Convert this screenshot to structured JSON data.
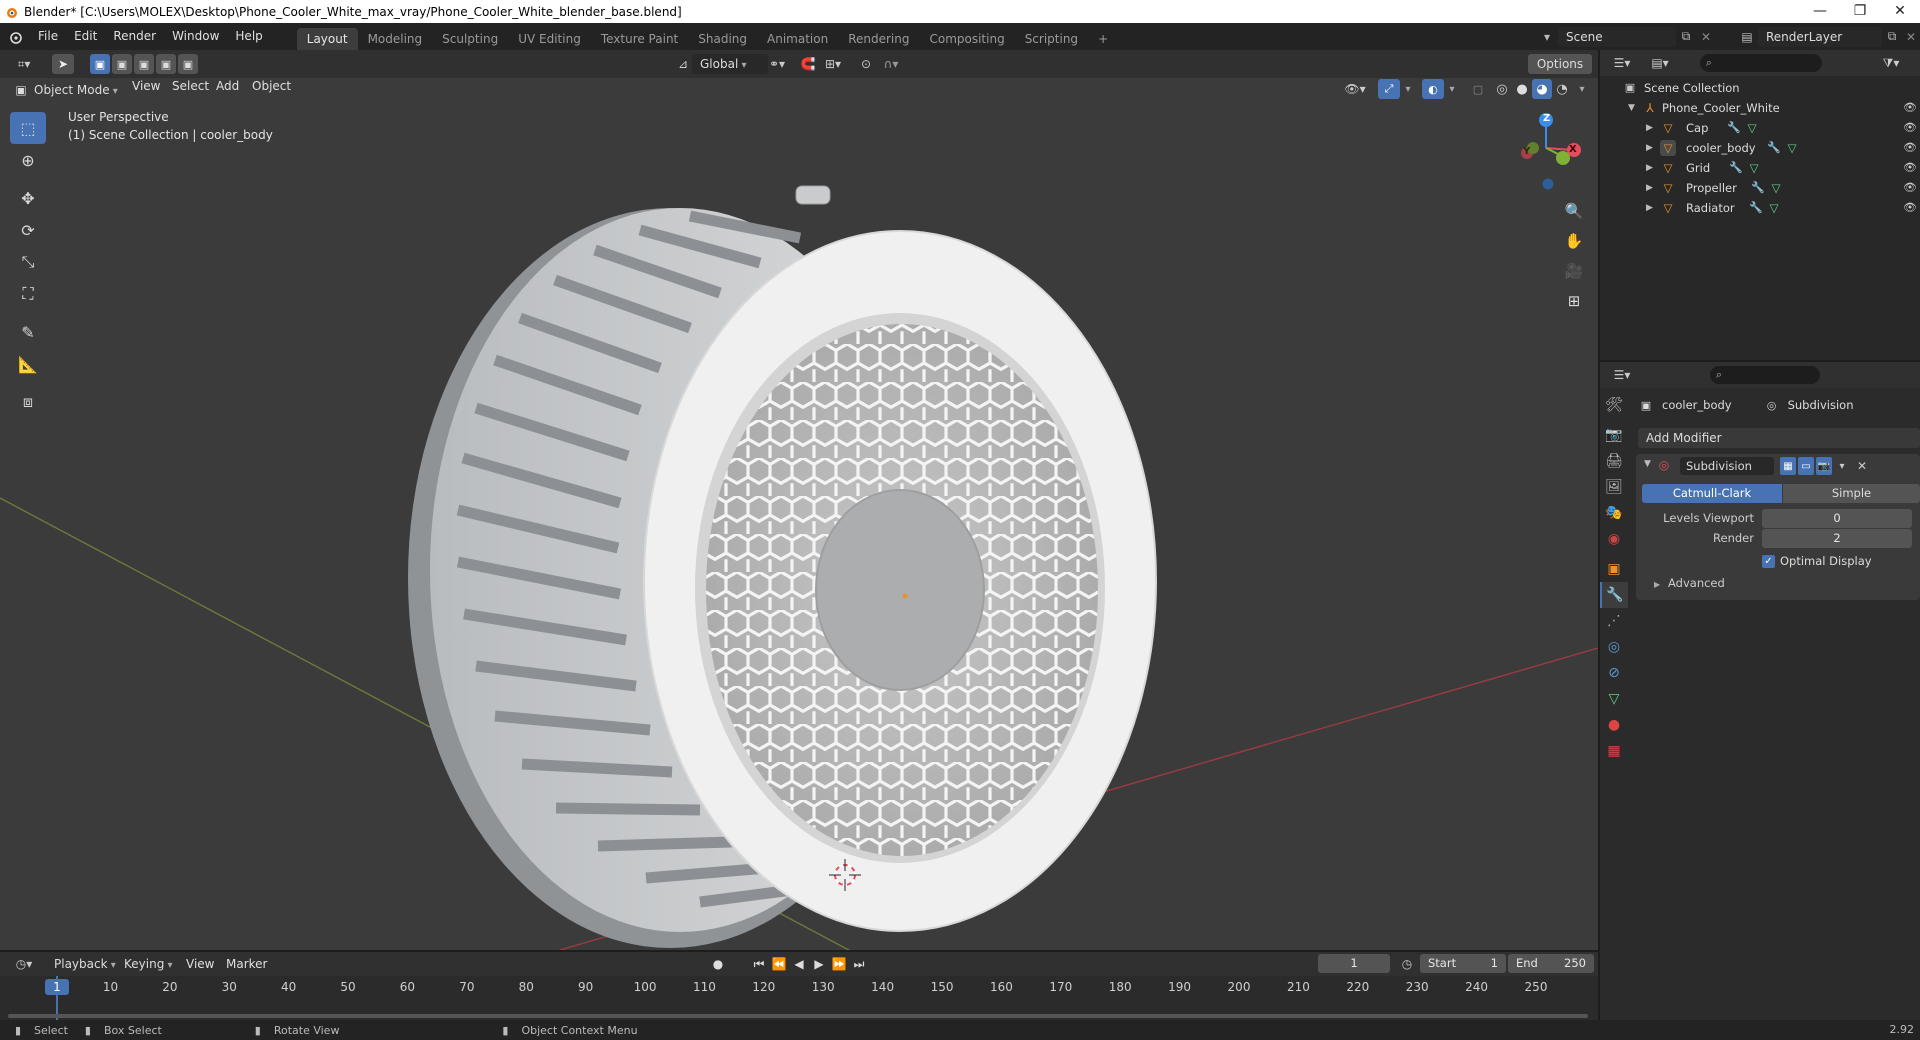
{
  "window": {
    "title": "Blender* [C:\\Users\\MOLEX\\Desktop\\Phone_Cooler_White_max_vray/Phone_Cooler_White_blender_base.blend]",
    "controls": [
      "—",
      "❐",
      "✕"
    ]
  },
  "menubar": {
    "items": [
      "File",
      "Edit",
      "Render",
      "Window",
      "Help"
    ],
    "workspaces": [
      "Layout",
      "Modeling",
      "Sculpting",
      "UV Editing",
      "Texture Paint",
      "Shading",
      "Animation",
      "Rendering",
      "Compositing",
      "Scripting"
    ],
    "active_workspace": "Layout",
    "add_tab": "+",
    "scene": "Scene",
    "view_layer": "RenderLayer"
  },
  "viewport_header": {
    "transform_orientation": "Global",
    "options": "Options",
    "mode": "Object Mode",
    "menus": [
      "View",
      "Select",
      "Add",
      "Object"
    ]
  },
  "viewport": {
    "perspective": "User Perspective",
    "collection_info": "(1) Scene Collection | cooler_body",
    "gizmo": {
      "z": "Z",
      "y": "Y",
      "x": "X"
    }
  },
  "outliner": {
    "root": "Scene Collection",
    "collection": "Phone_Cooler_White",
    "objects": [
      "Cap",
      "cooler_body",
      "Grid",
      "Propeller",
      "Radiator"
    ],
    "selected": "cooler_body"
  },
  "properties": {
    "object_name": "cooler_body",
    "modifier_name_header": "Subdivision",
    "add_modifier": "Add Modifier",
    "modifier": {
      "name": "Subdivision",
      "type_options": [
        "Catmull-Clark",
        "Simple"
      ],
      "active_type": "Catmull-Clark",
      "levels_viewport_label": "Levels Viewport",
      "levels_viewport": "0",
      "render_label": "Render",
      "render": "2",
      "optimal_display_label": "Optimal Display",
      "optimal_display": true,
      "advanced_label": "Advanced"
    }
  },
  "timeline": {
    "menus": [
      "Playback",
      "Keying",
      "View",
      "Marker"
    ],
    "current_frame": "1",
    "start_label": "Start",
    "start": "1",
    "end_label": "End",
    "end": "250",
    "ticks": [
      "1",
      "10",
      "20",
      "30",
      "40",
      "50",
      "60",
      "70",
      "80",
      "90",
      "100",
      "110",
      "120",
      "130",
      "140",
      "150",
      "160",
      "170",
      "180",
      "190",
      "200",
      "210",
      "220",
      "230",
      "240",
      "250"
    ]
  },
  "statusbar": {
    "select": "Select",
    "box_select": "Box Select",
    "rotate_view": "Rotate View",
    "context_menu": "Object Context Menu",
    "version": "2.92"
  },
  "colors": {
    "accent": "#4772b3",
    "x_axis": "#e64c5c",
    "y_axis": "#7fb234",
    "z_axis": "#3b8ee8",
    "object_orange": "#e8912e",
    "mesh_green": "#5fd18b"
  }
}
